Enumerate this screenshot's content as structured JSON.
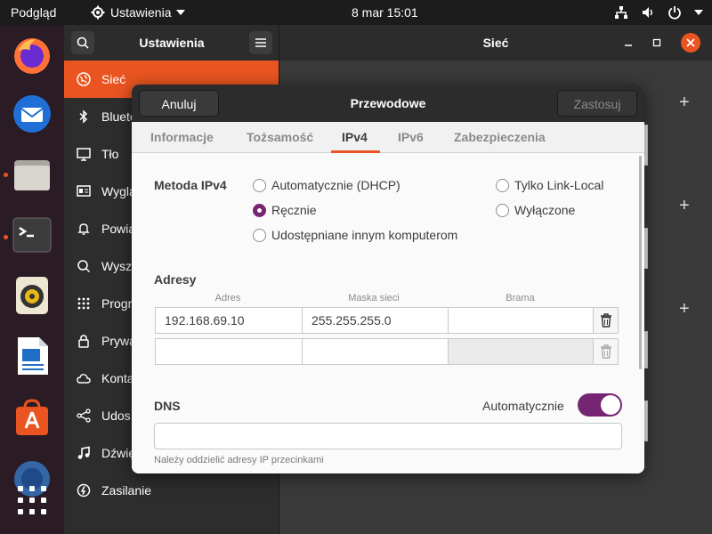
{
  "topbar": {
    "activities": "Podgląd",
    "app_name": "Ustawienia",
    "clock": "8 mar  15:01"
  },
  "dock": {
    "apps": [
      "firefox",
      "thunderbird",
      "files",
      "terminal",
      "rhythmbox",
      "libreoffice-writer",
      "app-center",
      "help",
      "show-apps"
    ]
  },
  "settings": {
    "sidebar_title": "Ustawienia",
    "panel_title": "Sieć",
    "sidebar_items": [
      {
        "label": "Sieć",
        "icon": "network-icon"
      },
      {
        "label": "Blueto",
        "icon": "bluetooth-icon"
      },
      {
        "label": "Tło",
        "icon": "background-icon"
      },
      {
        "label": "Wyglą",
        "icon": "appearance-icon"
      },
      {
        "label": "Powia",
        "icon": "bell-icon"
      },
      {
        "label": "Wyszu",
        "icon": "search-icon"
      },
      {
        "label": "Progra",
        "icon": "apps-grid-icon"
      },
      {
        "label": "Prywa",
        "icon": "lock-icon"
      },
      {
        "label": "Konta",
        "icon": "cloud-icon"
      },
      {
        "label": "Udos",
        "icon": "share-icon"
      },
      {
        "label": "Dźwięk",
        "icon": "music-note-icon"
      },
      {
        "label": "Zasilanie",
        "icon": "power-icon"
      }
    ]
  },
  "dialog": {
    "title": "Przewodowe",
    "cancel": "Anuluj",
    "apply": "Zastosuj",
    "tabs": [
      "Informacje",
      "Tożsamość",
      "IPv4",
      "IPv6",
      "Zabezpieczenia"
    ],
    "active_tab": "IPv4",
    "method": {
      "label": "Metoda IPv4",
      "options": {
        "dhcp": "Automatycznie (DHCP)",
        "manual": "Ręcznie",
        "shared": "Udostępniane innym komputerom",
        "link_local": "Tylko Link-Local",
        "disabled": "Wyłączone"
      },
      "selected": "manual"
    },
    "addresses": {
      "label": "Adresy",
      "col_address": "Adres",
      "col_netmask": "Maska sieci",
      "col_gateway": "Brama",
      "rows": [
        {
          "address": "192.168.69.10",
          "netmask": "255.255.255.0",
          "gateway": ""
        },
        {
          "address": "",
          "netmask": "",
          "gateway": ""
        }
      ]
    },
    "dns": {
      "label": "DNS",
      "auto_label": "Automatycznie",
      "auto_on": true,
      "value": "",
      "hint": "Należy oddzielić adresy IP przecinkami"
    }
  },
  "colors": {
    "accent": "#e95420",
    "selection": "#762572"
  }
}
